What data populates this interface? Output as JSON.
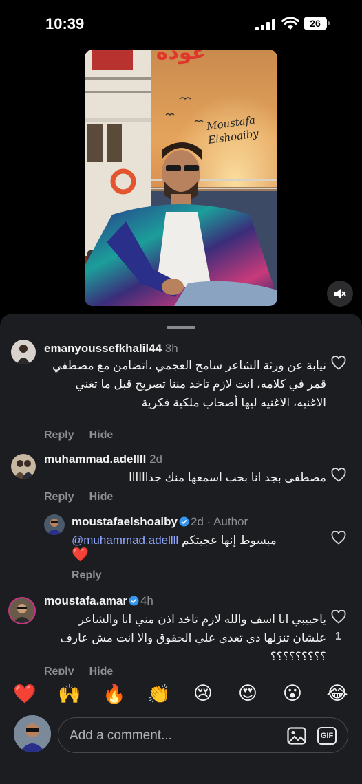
{
  "status_bar": {
    "time": "10:39",
    "battery": "26"
  },
  "post": {
    "poster_title": "عودة",
    "poster_artist_line1": "Moustafa",
    "poster_artist_line2": "Elshoaiby",
    "muted": true
  },
  "comments": [
    {
      "username": "emanyoussefkhalil44",
      "time": "3h",
      "text": "نيابة عن ورثة الشاعر سامح العجمي ،اتضامن مع مصطفي قمر في كلامه، انت لازم تاخد مننا تصريح قبل ما تغني الاغنيه، الاغنيه ليها أصحاب ملكية فكرية",
      "reply_label": "Reply",
      "hide_label": "Hide"
    },
    {
      "username": "muhammad.adellll",
      "time": "2d",
      "text": "مصطفى بجد انا بحب اسمعها منك جداااااا",
      "reply_label": "Reply",
      "hide_label": "Hide",
      "replies": [
        {
          "username": "moustafaelshoaiby",
          "time": "2d",
          "author_label": "Author",
          "mention": "@muhammad.adellll",
          "text": "مبسوط إنها عجبتكم",
          "emoji": "❤️",
          "reply_label": "Reply"
        }
      ]
    },
    {
      "username": "moustafa.amar",
      "time": "4h",
      "text": "ياحبيبي انا اسف والله لازم تاخد اذن مني انا والشاعر علشان تنزلها دي تعدي علي الحقوق والا انت مش عارف ؟؟؟؟؟؟؟؟؟",
      "like_count": "1",
      "reply_label": "Reply",
      "hide_label": "Hide"
    }
  ],
  "emoji_bar": [
    "❤️",
    "🙌",
    "🔥",
    "👏",
    "😢",
    "😍",
    "😮",
    "😂"
  ],
  "composer": {
    "placeholder": "Add a comment...",
    "gif_label": "GIF"
  },
  "colors": {
    "sheet_bg": "#1c1d21",
    "link": "#8fa7ff",
    "verified": "#3797f0",
    "muted_text": "#8e8e93"
  }
}
